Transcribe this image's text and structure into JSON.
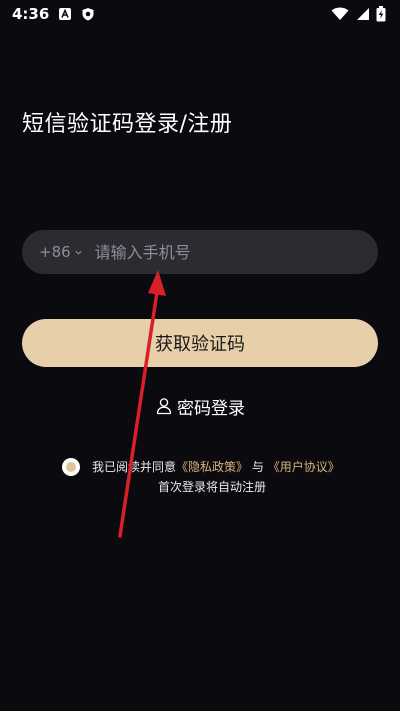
{
  "status_bar": {
    "time": "4:36",
    "left_icons": [
      "a-box-icon",
      "shield-icon"
    ],
    "right_icons": [
      "wifi-icon",
      "signal-icon",
      "battery-charging-icon"
    ]
  },
  "page": {
    "title": "短信验证码登录/注册"
  },
  "phone_field": {
    "country_code": "+86",
    "placeholder": "请输入手机号",
    "value": ""
  },
  "get_code_button": {
    "label": "获取验证码"
  },
  "password_login": {
    "label": "密码登录"
  },
  "agreement": {
    "prefix": "我已阅读并同意",
    "privacy_link": "《隐私政策》",
    "conjunction": "与",
    "user_agreement_link": "《用户协议》",
    "note": "首次登录将自动注册",
    "checked": true
  },
  "colors": {
    "background": "#0b0a0f",
    "input_bg": "#2c2b31",
    "accent": "#e7cfaa",
    "link": "#d8b47c",
    "annotation_arrow": "#d8202a"
  }
}
